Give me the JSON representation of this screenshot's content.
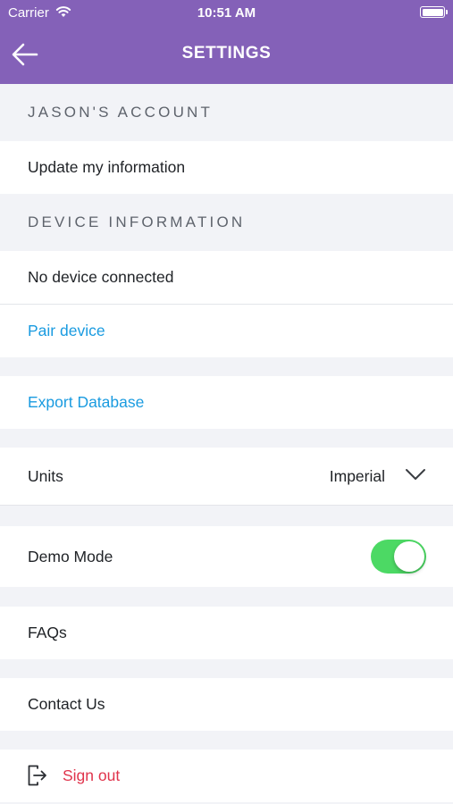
{
  "status_bar": {
    "carrier": "Carrier",
    "time": "10:51 AM"
  },
  "nav": {
    "title": "SETTINGS",
    "back_icon": "arrow-left-icon"
  },
  "sections": {
    "account_header": "JASON'S ACCOUNT",
    "device_header": "DEVICE INFORMATION"
  },
  "rows": {
    "update_info": "Update my information",
    "device_status": "No device connected",
    "pair_device": "Pair device",
    "export_database": "Export Database",
    "units_label": "Units",
    "units_value": "Imperial",
    "demo_mode_label": "Demo Mode",
    "demo_mode_on": true,
    "faqs": "FAQs",
    "contact_us": "Contact Us",
    "sign_out": "Sign out"
  },
  "colors": {
    "header_purple": "#8461b8",
    "link_blue": "#1a9be0",
    "toggle_green": "#4cd964",
    "sign_out_red": "#e0344c"
  }
}
